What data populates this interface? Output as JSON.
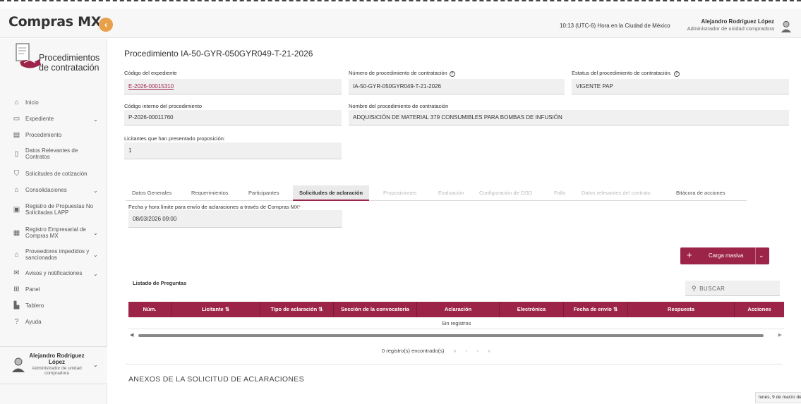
{
  "header": {
    "logo": "Compras MX",
    "time": "10:13 (UTC-6) Hora en la Ciudad de México",
    "user_name": "Alejandro Rodríguez López",
    "user_role": "Administrador de unidad compradora"
  },
  "sidebar": {
    "title_line1": "Procedimientos",
    "title_line2": "de contratación",
    "items": [
      {
        "label": "Inicio",
        "icon": "home-icon"
      },
      {
        "label": "Expediente",
        "icon": "folder-icon",
        "expandable": true
      },
      {
        "label": "Procedimiento",
        "icon": "document-icon"
      },
      {
        "label": "Datos Relevantes de Contratos",
        "icon": "bookmark-icon"
      },
      {
        "label": "Solicitudes de cotización",
        "icon": "cart-icon"
      },
      {
        "label": "Consolidaciones",
        "icon": "institution-icon",
        "expandable": true
      },
      {
        "label": "Registro de Propuestas No Solicitadas LAPP",
        "icon": "upload-file-icon"
      },
      {
        "label": "Registro Empresarial de Compras MX",
        "icon": "id-card-icon",
        "expandable": true
      },
      {
        "label": "Proveedores impedidos y sancionados",
        "icon": "institution-icon",
        "expandable": true
      },
      {
        "label": "Avisos y notificaciones",
        "icon": "mail-icon",
        "expandable": true
      },
      {
        "label": "Panel",
        "icon": "grid-icon"
      },
      {
        "label": "Tablero",
        "icon": "bar-chart-icon"
      },
      {
        "label": "Ayuda",
        "icon": "help-icon"
      }
    ],
    "user_name": "Alejandro Rodríguez López",
    "user_role": "Administrador de unidad compradora"
  },
  "main": {
    "title": "Procedimiento IA-50-GYR-050GYR049-T-21-2026",
    "fields": {
      "codigo_expediente_label": "Código del expediente",
      "codigo_expediente_value": "E-2026-00015310",
      "numero_procedimiento_label": "Número de procedimiento de contratación",
      "numero_procedimiento_value": "IA-50-GYR-050GYR049-T-21-2026",
      "estatus_label": "Estatus del procedimiento de contratación.",
      "estatus_value": "VIGENTE PAP",
      "codigo_interno_label": "Código interno del procedimiento",
      "codigo_interno_value": "P-2026-00011760",
      "nombre_label": "Nombre del procedimiento de contratación",
      "nombre_value": "ADQUISICIÓN DE MATERIAL 379 CONSUMIBLES PARA BOMBAS DE INFUSIÓN",
      "licitantes_label": "Licitantes que han presentado proposición:",
      "licitantes_value": "1"
    },
    "tabs": [
      {
        "label": "Datos Generales",
        "state": "enabled"
      },
      {
        "label": "Requerimientos",
        "state": "enabled"
      },
      {
        "label": "Participantes",
        "state": "enabled"
      },
      {
        "label": "Solicitudes de aclaración",
        "state": "active"
      },
      {
        "label": "Proposiciones",
        "state": "disabled"
      },
      {
        "label": "Evaluación",
        "state": "disabled"
      },
      {
        "label": "Configuración de OSD",
        "state": "disabled"
      },
      {
        "label": "Fallo",
        "state": "disabled"
      },
      {
        "label": "Datos relevantes del contrato",
        "state": "disabled"
      },
      {
        "label": "Bitácora de acciones",
        "state": "enabled"
      }
    ],
    "fecha_limite_label": "Fecha y hora límite para envío de aclaraciones a través de Compras MX",
    "fecha_limite_required": "*",
    "fecha_limite_value": "08/03/2026 09:00",
    "carga_masiva_label": "Carga masiva",
    "listado_title": "Listado de Preguntas",
    "search_placeholder": "BUSCAR",
    "table_headers": [
      "Núm.",
      "Licitante",
      "Tipo de aclaración",
      "Sección de la convocatoria",
      "Aclaración",
      "Electrónica",
      "Fecha de envío",
      "Respuesta",
      "Acciones"
    ],
    "sortable_columns": [
      "Licitante",
      "Tipo de aclaración",
      "Fecha de envío"
    ],
    "no_records": "Sin registros",
    "pager_text": "0 registro(s) encontrado(s)",
    "annex_title": "ANEXOS DE LA SOLICITUD DE ACLARACIONES",
    "date_footer": "lunes, 9 de marzo de 2"
  },
  "colors": {
    "accent": "#9d2449",
    "toggle": "#e8a04a"
  }
}
